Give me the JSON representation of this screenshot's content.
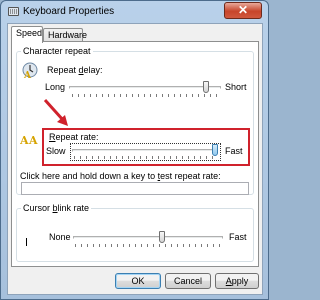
{
  "window": {
    "title": "Keyboard Properties",
    "close_glyph": "✕"
  },
  "tabs": [
    {
      "label": "Speed",
      "active": true
    },
    {
      "label": "Hardware",
      "active": false
    }
  ],
  "character_repeat": {
    "group_label": "Character repeat",
    "repeat_delay": {
      "label_pre": "Repeat ",
      "label_accel": "d",
      "label_post": "elay:",
      "min_label": "Long",
      "max_label": "Short",
      "level": 0.92,
      "icon": "keyboard-delay-icon"
    },
    "repeat_rate": {
      "label_accel": "R",
      "label_post": "epeat rate:",
      "min_label": "Slow",
      "max_label": "Fast",
      "level": 1.0,
      "icon": "repeat-rate-icon"
    },
    "test_prompt_pre": "Click here and hold down a key to ",
    "test_prompt_accel": "t",
    "test_prompt_post": "est repeat rate:",
    "test_value": ""
  },
  "cursor_blink": {
    "group_label_pre": "Cursor ",
    "group_label_accel": "b",
    "group_label_post": "link rate",
    "min_label": "None",
    "max_label": "Fast",
    "level": 0.6
  },
  "buttons": {
    "ok": "OK",
    "cancel": "Cancel",
    "apply": "Apply"
  },
  "annotation": {
    "highlight_color": "#d0222c"
  }
}
